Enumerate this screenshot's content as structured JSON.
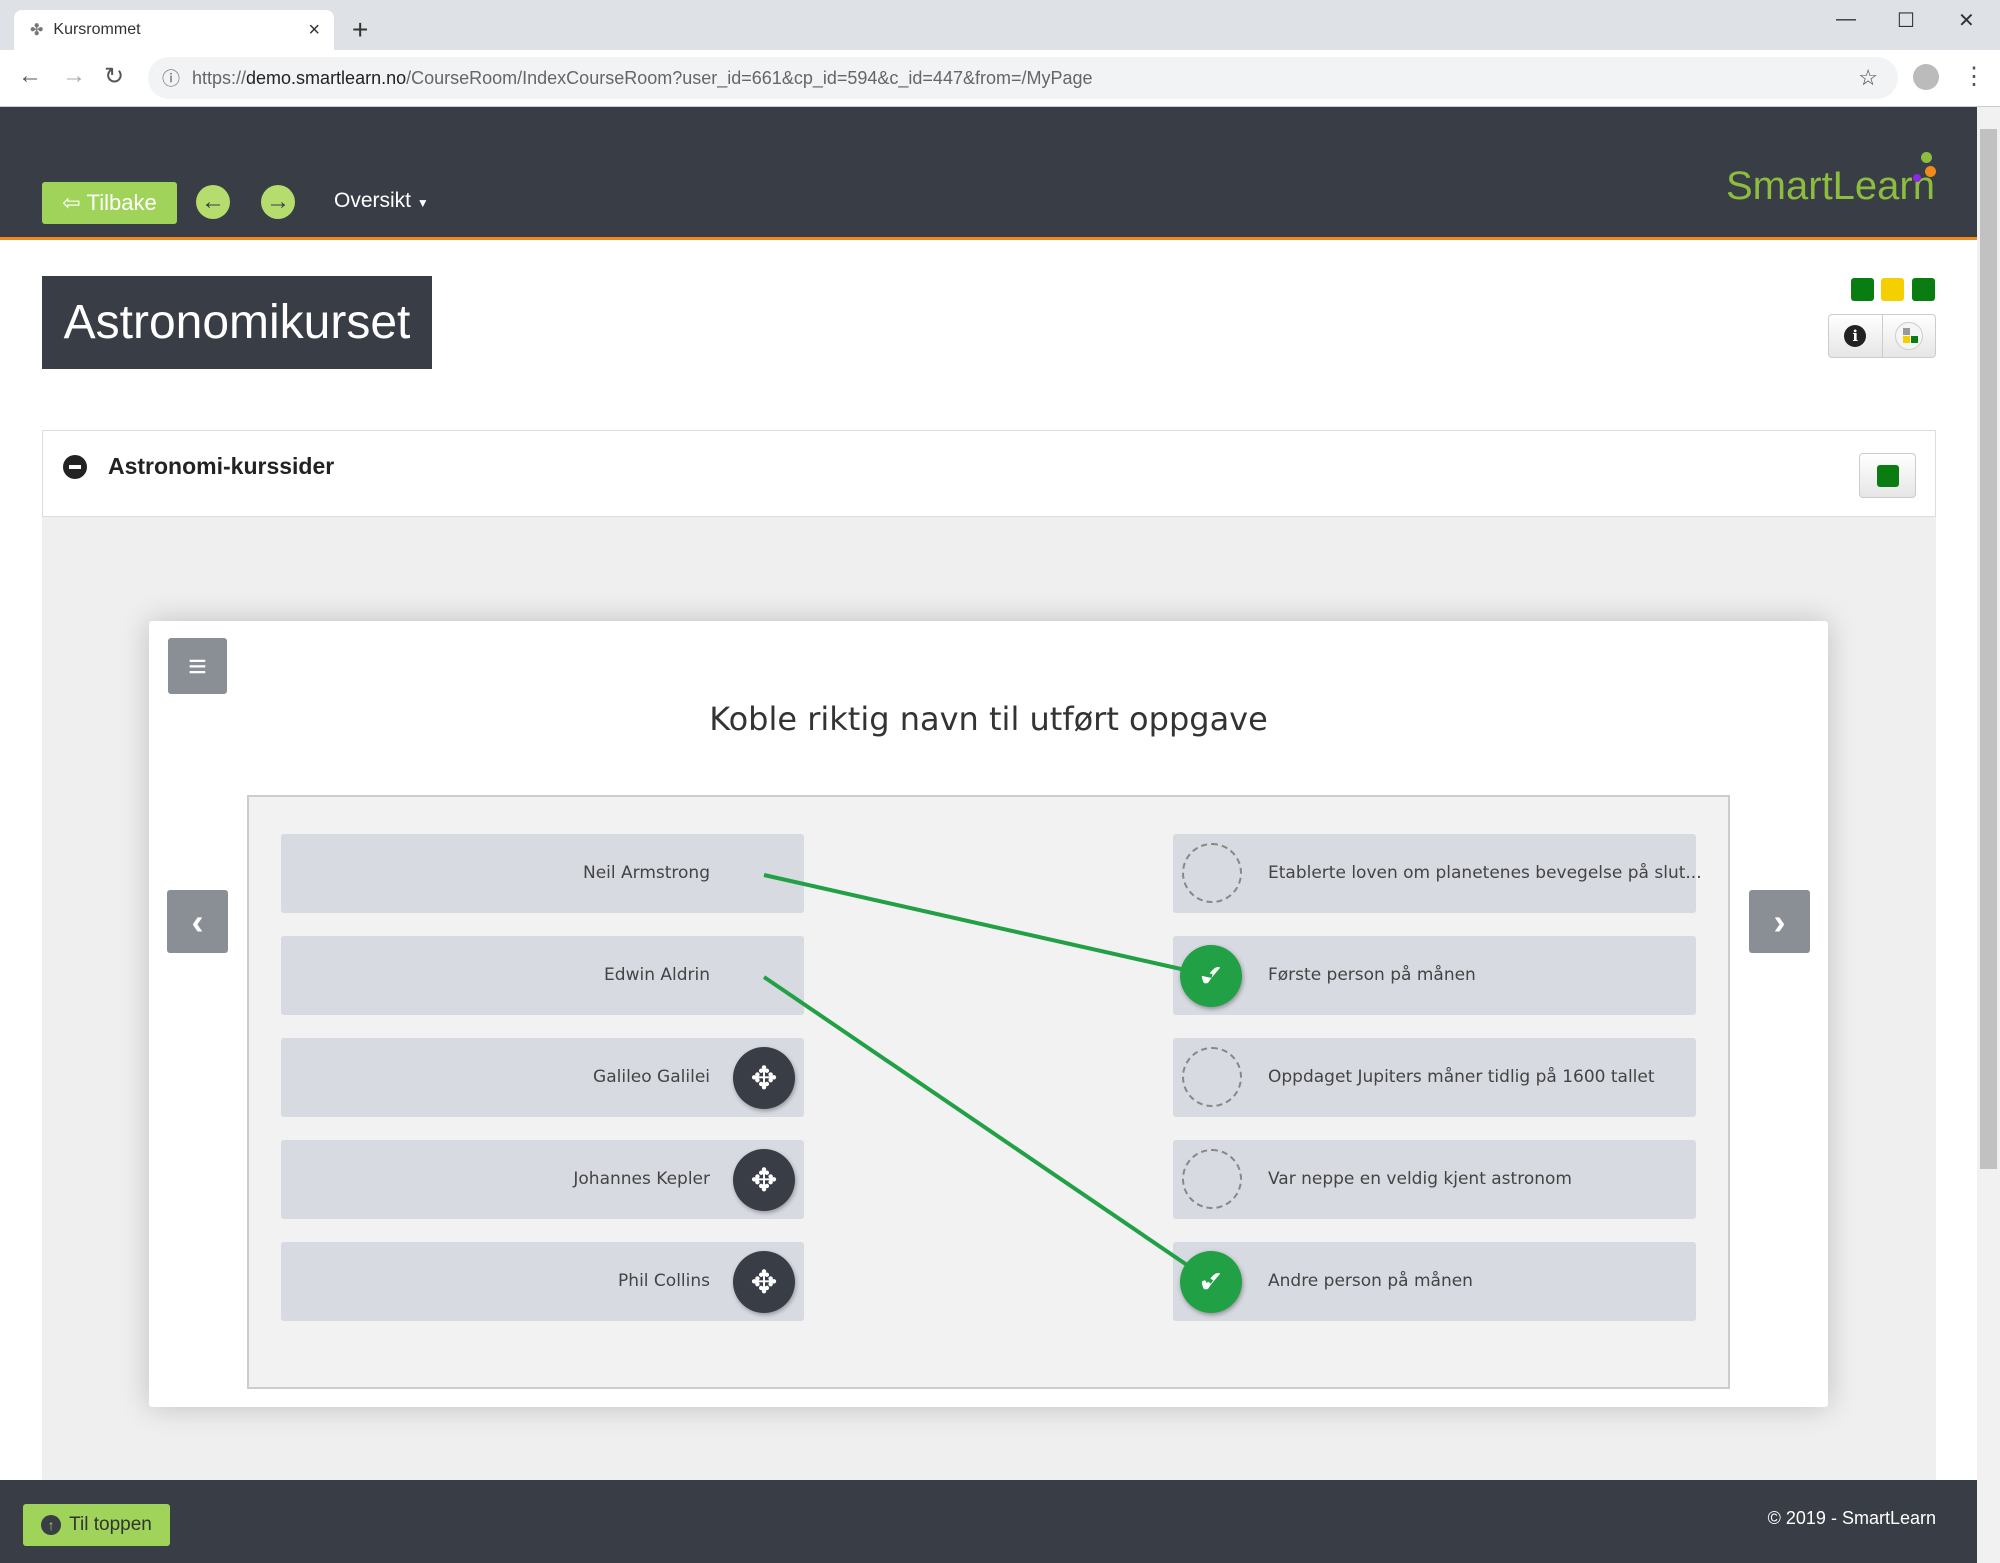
{
  "browser": {
    "tab_title": "Kursrommet",
    "tab_close": "×",
    "new_tab": "+",
    "url_prefix": "https://",
    "url_domain": "demo.smartlearn.no",
    "url_path": "/CourseRoom/IndexCourseRoom?user_id=661&cp_id=594&c_id=447&from=/MyPage",
    "window_controls": [
      "—",
      "☐",
      "✕"
    ]
  },
  "header": {
    "back_label": "Tilbake",
    "nav_dropdown": "Oversikt",
    "logo": "SmartLearn"
  },
  "course": {
    "title": "Astronomikurset",
    "status_colors": [
      "#0a7d12",
      "#f5d000",
      "#0a7d12"
    ]
  },
  "section": {
    "title": "Astronomi-kurssider",
    "status_color": "#0a7d12"
  },
  "exercise": {
    "title": "Koble riktig navn til utført oppgave",
    "left_items": [
      {
        "label": "Neil Armstrong",
        "connected": true
      },
      {
        "label": "Edwin Aldrin",
        "connected": true
      },
      {
        "label": "Galileo Galilei",
        "connected": false
      },
      {
        "label": "Johannes Kepler",
        "connected": false
      },
      {
        "label": "Phil Collins",
        "connected": false
      }
    ],
    "right_items": [
      {
        "label": "Etablerte loven om planetenes bevegelse på slut...",
        "matched": false
      },
      {
        "label": "Første person på månen",
        "matched": true
      },
      {
        "label": "Oppdaget Jupiters måner tidlig på 1600 tallet",
        "matched": false
      },
      {
        "label": "Var neppe en veldig kjent astronom",
        "matched": false
      },
      {
        "label": "Andre person på månen",
        "matched": true
      }
    ],
    "connections": [
      {
        "from": "Neil Armstrong",
        "to": "Første person på månen"
      },
      {
        "from": "Edwin Aldrin",
        "to": "Andre person på månen"
      }
    ],
    "line_color": "#22a045"
  },
  "footer": {
    "to_top_label": "Til toppen",
    "copyright": "© 2019 - SmartLearn"
  }
}
